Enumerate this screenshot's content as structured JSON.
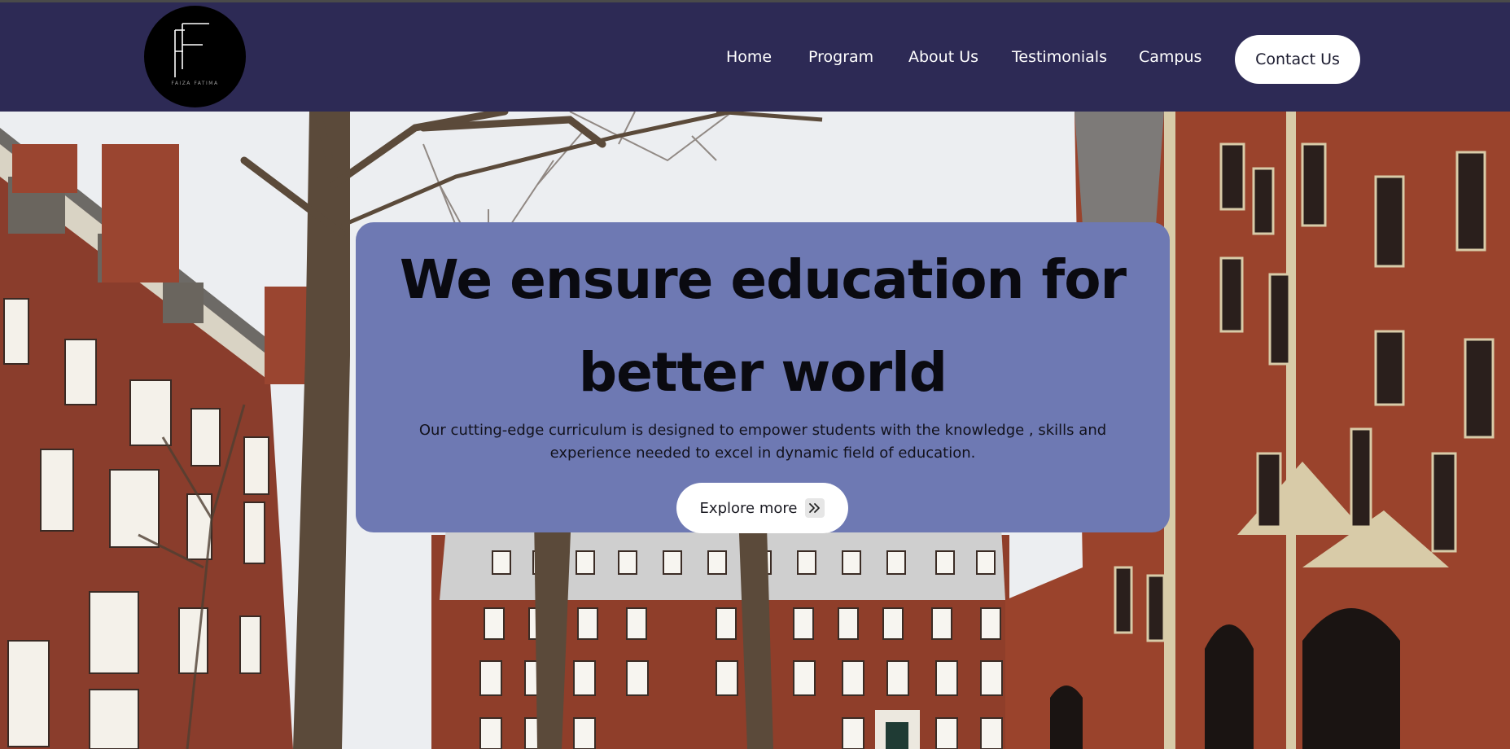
{
  "logo": {
    "caption": "FAIZA FATIMA",
    "icon": "ff-monogram-logo"
  },
  "nav": {
    "items": [
      {
        "label": "Home"
      },
      {
        "label": "Program"
      },
      {
        "label": "About Us"
      },
      {
        "label": "Testimonials"
      },
      {
        "label": "Campus"
      }
    ],
    "contact_label": "Contact Us"
  },
  "hero": {
    "headline_line1": "We ensure education for",
    "headline_line2": "better world",
    "description_line1": "Our cutting-edge curriculum is designed to empower students with the knowledge , skills and",
    "description_line2": "experience needed to excel in dynamic field of education.",
    "cta_label": "Explore more",
    "cta_icon": "double-chevron-right-icon",
    "background": "campus-brick-buildings-photo"
  },
  "colors": {
    "navbar_bg": "#2d2a55",
    "card_bg": "#6e79b3",
    "button_bg": "#ffffff",
    "text_dark": "#0a0a10"
  }
}
